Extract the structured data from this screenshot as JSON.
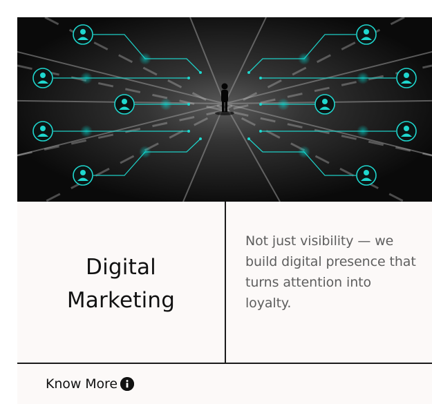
{
  "hero": {
    "image_label": "network-people-night-scene",
    "accent_color": "#00d2c8"
  },
  "service": {
    "title_line1": "Digital",
    "title_line2": "Marketing",
    "description": "Not just visibility — we build digital presence that turns attention into loyalty."
  },
  "footer": {
    "cta_label": "Know More",
    "cta_icon": "info-icon"
  }
}
